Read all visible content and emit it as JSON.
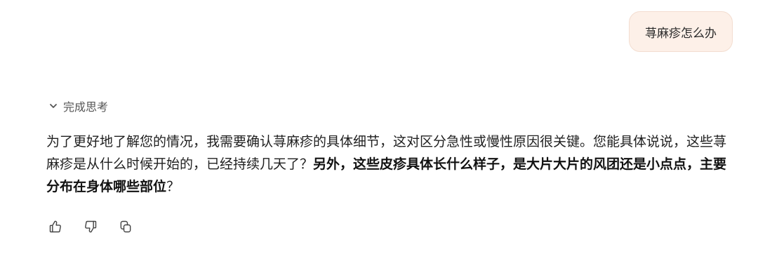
{
  "user_message": {
    "text": "荨麻疹怎么办"
  },
  "thinking": {
    "label": "完成思考",
    "icon": "chevron-down-icon"
  },
  "answer": {
    "segments": {
      "s1": "为了更好地了解您的情况，我需要确认荨麻疹的具体细节，这对区分急性或慢性原因很关键。您能具体说说，这些荨麻疹是从什么时候开始的，已经持续几天了？",
      "s2_bold": "另外，这些皮疹具体长什么样子，是大片大片的风团还是小点点，主要分布在身体哪些部位",
      "s3": "？"
    }
  },
  "actions": {
    "icons": [
      "thumbs-up-icon",
      "thumbs-down-icon",
      "copy-icon"
    ]
  }
}
